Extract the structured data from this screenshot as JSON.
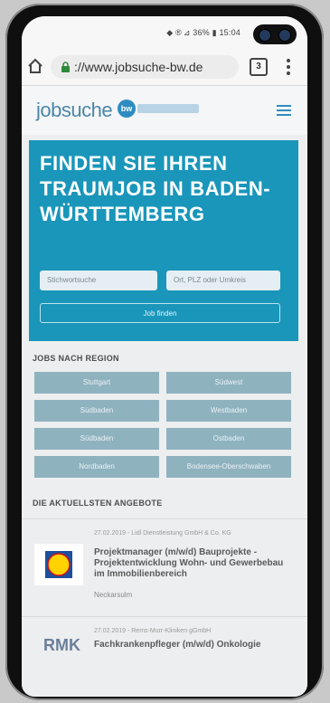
{
  "status": {
    "text": "◆ ® ⊿ 36% ▮ 15:04"
  },
  "browser": {
    "url": "://www.jobsuche-bw.de",
    "tab_count": "3"
  },
  "site": {
    "logo_text": "jobsuche",
    "logo_badge": "bw"
  },
  "hero": {
    "title": "FINDEN SIE IHREN TRAUMJOB IN BADEN-WÜRTTEMBERG",
    "input1_placeholder": "Stichwortsuche",
    "input2_placeholder": "Ort, PLZ oder Umkreis",
    "button_label": "Job finden"
  },
  "regions": {
    "title": "JOBS NACH REGION",
    "items": [
      "Stuttgart",
      "Südwest",
      "Südbaden",
      "Westbaden",
      "Südbaden",
      "Ostbaden",
      "Nordbaden",
      "Bodensee-Oberschwaben"
    ]
  },
  "offers": {
    "title": "DIE AKTUELLSTEN ANGEBOTE",
    "items": [
      {
        "meta": "27.02.2019 - Lidl Dienstleistung GmbH & Co. KG",
        "title": "Projektmanager (m/w/d) Bauprojekte - Projektentwicklung Wohn- und Gewerbebau im Immobilienbereich",
        "location": "Neckarsulm",
        "logo": "LIDL"
      },
      {
        "meta": "27.02.2019 - Rems-Murr-Kliniken gGmbH",
        "title": "Fachkrankenpfleger (m/w/d) Onkologie",
        "location": "",
        "logo": "RMK"
      }
    ]
  },
  "colors": {
    "hero": "#1a96ba",
    "region_btn": "#8fb2bf",
    "brand": "#2f8cc0"
  }
}
